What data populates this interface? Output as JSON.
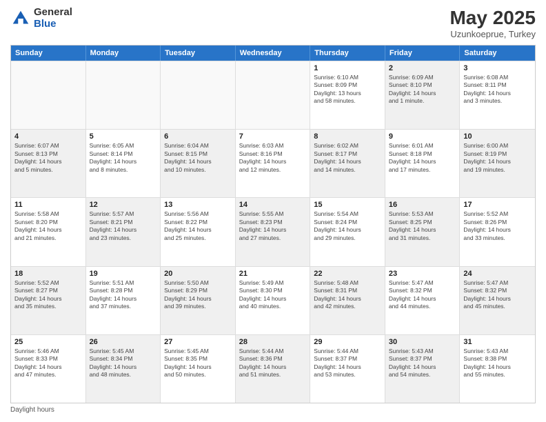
{
  "header": {
    "logo_general": "General",
    "logo_blue": "Blue",
    "main_title": "May 2025",
    "subtitle": "Uzunkoeprue, Turkey"
  },
  "days_of_week": [
    "Sunday",
    "Monday",
    "Tuesday",
    "Wednesday",
    "Thursday",
    "Friday",
    "Saturday"
  ],
  "footer": "Daylight hours",
  "weeks": [
    [
      {
        "day": "",
        "text": "",
        "shaded": false,
        "empty": true
      },
      {
        "day": "",
        "text": "",
        "shaded": false,
        "empty": true
      },
      {
        "day": "",
        "text": "",
        "shaded": false,
        "empty": true
      },
      {
        "day": "",
        "text": "",
        "shaded": false,
        "empty": true
      },
      {
        "day": "1",
        "text": "Sunrise: 6:10 AM\nSunset: 8:09 PM\nDaylight: 13 hours\nand 58 minutes.",
        "shaded": false,
        "empty": false
      },
      {
        "day": "2",
        "text": "Sunrise: 6:09 AM\nSunset: 8:10 PM\nDaylight: 14 hours\nand 1 minute.",
        "shaded": true,
        "empty": false
      },
      {
        "day": "3",
        "text": "Sunrise: 6:08 AM\nSunset: 8:11 PM\nDaylight: 14 hours\nand 3 minutes.",
        "shaded": false,
        "empty": false
      }
    ],
    [
      {
        "day": "4",
        "text": "Sunrise: 6:07 AM\nSunset: 8:13 PM\nDaylight: 14 hours\nand 5 minutes.",
        "shaded": true,
        "empty": false
      },
      {
        "day": "5",
        "text": "Sunrise: 6:05 AM\nSunset: 8:14 PM\nDaylight: 14 hours\nand 8 minutes.",
        "shaded": false,
        "empty": false
      },
      {
        "day": "6",
        "text": "Sunrise: 6:04 AM\nSunset: 8:15 PM\nDaylight: 14 hours\nand 10 minutes.",
        "shaded": true,
        "empty": false
      },
      {
        "day": "7",
        "text": "Sunrise: 6:03 AM\nSunset: 8:16 PM\nDaylight: 14 hours\nand 12 minutes.",
        "shaded": false,
        "empty": false
      },
      {
        "day": "8",
        "text": "Sunrise: 6:02 AM\nSunset: 8:17 PM\nDaylight: 14 hours\nand 14 minutes.",
        "shaded": true,
        "empty": false
      },
      {
        "day": "9",
        "text": "Sunrise: 6:01 AM\nSunset: 8:18 PM\nDaylight: 14 hours\nand 17 minutes.",
        "shaded": false,
        "empty": false
      },
      {
        "day": "10",
        "text": "Sunrise: 6:00 AM\nSunset: 8:19 PM\nDaylight: 14 hours\nand 19 minutes.",
        "shaded": true,
        "empty": false
      }
    ],
    [
      {
        "day": "11",
        "text": "Sunrise: 5:58 AM\nSunset: 8:20 PM\nDaylight: 14 hours\nand 21 minutes.",
        "shaded": false,
        "empty": false
      },
      {
        "day": "12",
        "text": "Sunrise: 5:57 AM\nSunset: 8:21 PM\nDaylight: 14 hours\nand 23 minutes.",
        "shaded": true,
        "empty": false
      },
      {
        "day": "13",
        "text": "Sunrise: 5:56 AM\nSunset: 8:22 PM\nDaylight: 14 hours\nand 25 minutes.",
        "shaded": false,
        "empty": false
      },
      {
        "day": "14",
        "text": "Sunrise: 5:55 AM\nSunset: 8:23 PM\nDaylight: 14 hours\nand 27 minutes.",
        "shaded": true,
        "empty": false
      },
      {
        "day": "15",
        "text": "Sunrise: 5:54 AM\nSunset: 8:24 PM\nDaylight: 14 hours\nand 29 minutes.",
        "shaded": false,
        "empty": false
      },
      {
        "day": "16",
        "text": "Sunrise: 5:53 AM\nSunset: 8:25 PM\nDaylight: 14 hours\nand 31 minutes.",
        "shaded": true,
        "empty": false
      },
      {
        "day": "17",
        "text": "Sunrise: 5:52 AM\nSunset: 8:26 PM\nDaylight: 14 hours\nand 33 minutes.",
        "shaded": false,
        "empty": false
      }
    ],
    [
      {
        "day": "18",
        "text": "Sunrise: 5:52 AM\nSunset: 8:27 PM\nDaylight: 14 hours\nand 35 minutes.",
        "shaded": true,
        "empty": false
      },
      {
        "day": "19",
        "text": "Sunrise: 5:51 AM\nSunset: 8:28 PM\nDaylight: 14 hours\nand 37 minutes.",
        "shaded": false,
        "empty": false
      },
      {
        "day": "20",
        "text": "Sunrise: 5:50 AM\nSunset: 8:29 PM\nDaylight: 14 hours\nand 39 minutes.",
        "shaded": true,
        "empty": false
      },
      {
        "day": "21",
        "text": "Sunrise: 5:49 AM\nSunset: 8:30 PM\nDaylight: 14 hours\nand 40 minutes.",
        "shaded": false,
        "empty": false
      },
      {
        "day": "22",
        "text": "Sunrise: 5:48 AM\nSunset: 8:31 PM\nDaylight: 14 hours\nand 42 minutes.",
        "shaded": true,
        "empty": false
      },
      {
        "day": "23",
        "text": "Sunrise: 5:47 AM\nSunset: 8:32 PM\nDaylight: 14 hours\nand 44 minutes.",
        "shaded": false,
        "empty": false
      },
      {
        "day": "24",
        "text": "Sunrise: 5:47 AM\nSunset: 8:32 PM\nDaylight: 14 hours\nand 45 minutes.",
        "shaded": true,
        "empty": false
      }
    ],
    [
      {
        "day": "25",
        "text": "Sunrise: 5:46 AM\nSunset: 8:33 PM\nDaylight: 14 hours\nand 47 minutes.",
        "shaded": false,
        "empty": false
      },
      {
        "day": "26",
        "text": "Sunrise: 5:45 AM\nSunset: 8:34 PM\nDaylight: 14 hours\nand 48 minutes.",
        "shaded": true,
        "empty": false
      },
      {
        "day": "27",
        "text": "Sunrise: 5:45 AM\nSunset: 8:35 PM\nDaylight: 14 hours\nand 50 minutes.",
        "shaded": false,
        "empty": false
      },
      {
        "day": "28",
        "text": "Sunrise: 5:44 AM\nSunset: 8:36 PM\nDaylight: 14 hours\nand 51 minutes.",
        "shaded": true,
        "empty": false
      },
      {
        "day": "29",
        "text": "Sunrise: 5:44 AM\nSunset: 8:37 PM\nDaylight: 14 hours\nand 53 minutes.",
        "shaded": false,
        "empty": false
      },
      {
        "day": "30",
        "text": "Sunrise: 5:43 AM\nSunset: 8:37 PM\nDaylight: 14 hours\nand 54 minutes.",
        "shaded": true,
        "empty": false
      },
      {
        "day": "31",
        "text": "Sunrise: 5:43 AM\nSunset: 8:38 PM\nDaylight: 14 hours\nand 55 minutes.",
        "shaded": false,
        "empty": false
      }
    ]
  ]
}
